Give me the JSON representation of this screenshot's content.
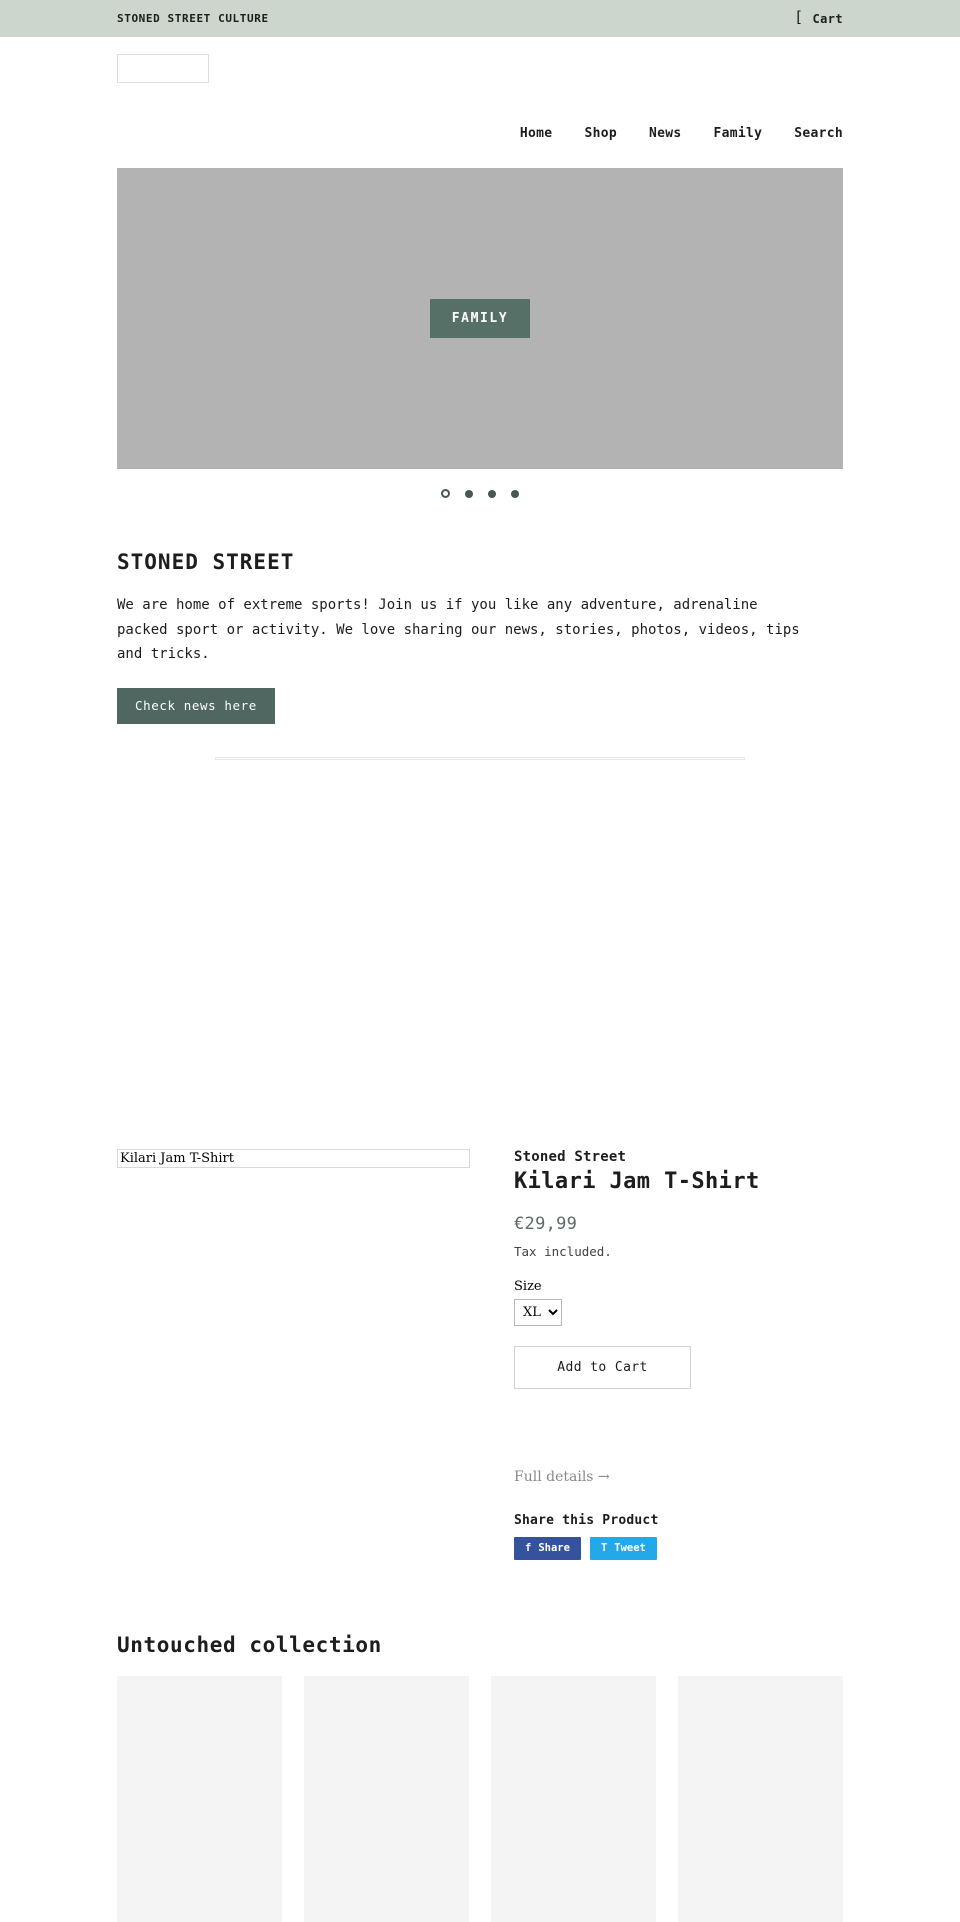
{
  "announcement": {
    "text": "STONED STREET CULTURE",
    "cart_label": "Cart",
    "cart_icon": "shopping-cart-icon",
    "background_color": "#ccd6cd"
  },
  "header": {
    "logo_alt": "",
    "nav": [
      {
        "label": "Home"
      },
      {
        "label": "Shop"
      },
      {
        "label": "News"
      },
      {
        "label": "Family"
      },
      {
        "label": "Search"
      }
    ]
  },
  "hero": {
    "cta_label": "FAMILY",
    "cta_color": "#567068",
    "background_color": "#b3b3b3",
    "slides": [
      {
        "active": true
      },
      {
        "active": false
      },
      {
        "active": false
      },
      {
        "active": false
      }
    ]
  },
  "richtext": {
    "heading": "STONED STREET",
    "body": "We are home of extreme sports! Join us if you like any adventure, adrenaline packed sport or activity. We love sharing our news, stories, photos, videos, tips and tricks.",
    "button_label": "Check news here",
    "button_color": "#4f6760"
  },
  "featured_product": {
    "image_alt": "Kilari Jam T-Shirt",
    "vendor": "Stoned Street",
    "title": "Kilari Jam T-Shirt",
    "price": "€29,99",
    "tax_note": "Tax included.",
    "size_label": "Size",
    "size_selected": "XL",
    "size_options": [
      "XL"
    ],
    "add_to_cart_label": "Add to Cart",
    "full_details_label": "Full details →",
    "share_heading": "Share this Product",
    "share_buttons": [
      {
        "icon": "facebook-icon",
        "glyph": "f",
        "label": "Share",
        "color": "#35529c"
      },
      {
        "icon": "twitter-icon",
        "glyph": "T",
        "label": "Tweet",
        "color": "#25a8e8"
      }
    ]
  },
  "collection": {
    "heading": "Untouched collection",
    "cards": [
      {
        "placeholder": true
      },
      {
        "placeholder": true
      },
      {
        "placeholder": true
      },
      {
        "placeholder": true
      }
    ]
  }
}
